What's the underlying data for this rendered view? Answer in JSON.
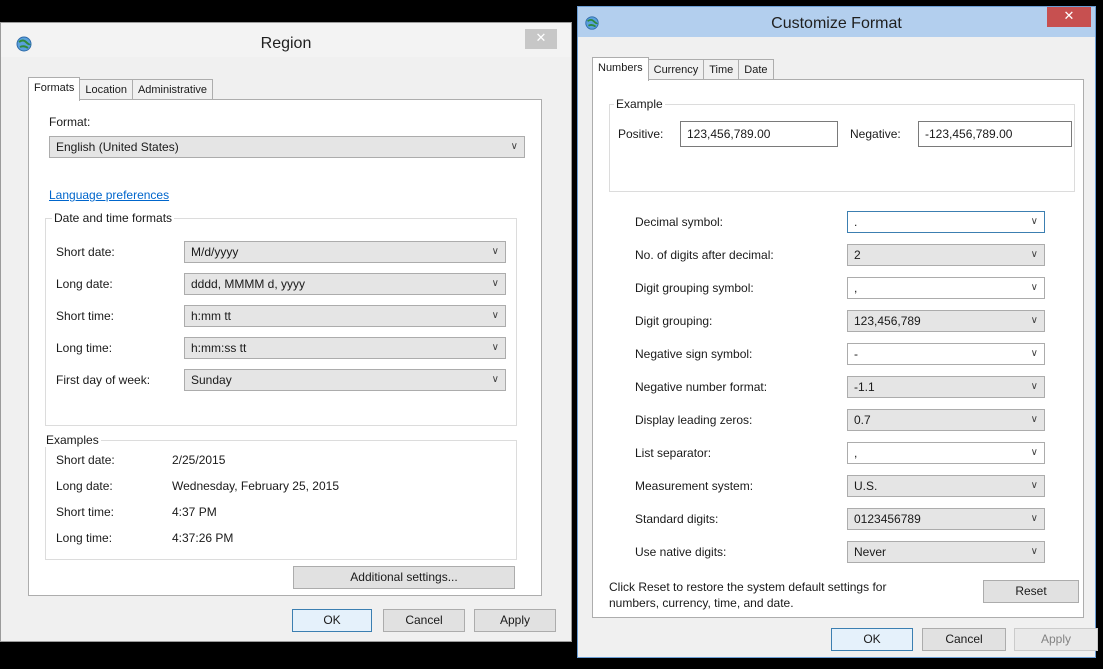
{
  "region": {
    "title": "Region",
    "close_glyph": "✕",
    "tabs": [
      {
        "label": "Formats"
      },
      {
        "label": "Location"
      },
      {
        "label": "Administrative"
      }
    ],
    "format_label": "Format:",
    "format_value": "English (United States)",
    "language_link": "Language preferences",
    "dt_group_title": "Date and time formats",
    "dt_rows": [
      {
        "label": "Short date:",
        "value": "M/d/yyyy"
      },
      {
        "label": "Long date:",
        "value": "dddd, MMMM d, yyyy"
      },
      {
        "label": "Short time:",
        "value": "h:mm tt"
      },
      {
        "label": "Long time:",
        "value": "h:mm:ss tt"
      },
      {
        "label": "First day of week:",
        "value": "Sunday"
      }
    ],
    "examples_title": "Examples",
    "examples": [
      {
        "label": "Short date:",
        "value": "2/25/2015"
      },
      {
        "label": "Long date:",
        "value": "Wednesday, February 25, 2015"
      },
      {
        "label": "Short time:",
        "value": "4:37 PM"
      },
      {
        "label": "Long time:",
        "value": "4:37:26 PM"
      }
    ],
    "additional_settings": "Additional settings...",
    "ok": "OK",
    "cancel": "Cancel",
    "apply": "Apply"
  },
  "custom": {
    "title": "Customize Format",
    "close_glyph": "✕",
    "tabs": [
      {
        "label": "Numbers"
      },
      {
        "label": "Currency"
      },
      {
        "label": "Time"
      },
      {
        "label": "Date"
      }
    ],
    "example_title": "Example",
    "positive_label": "Positive:",
    "positive_value": "123,456,789.00",
    "negative_label": "Negative:",
    "negative_value": "-123,456,789.00",
    "rows": [
      {
        "label": "Decimal symbol:",
        "value": "."
      },
      {
        "label": "No. of digits after decimal:",
        "value": "2"
      },
      {
        "label": "Digit grouping symbol:",
        "value": ","
      },
      {
        "label": "Digit grouping:",
        "value": "123,456,789"
      },
      {
        "label": "Negative sign symbol:",
        "value": "-"
      },
      {
        "label": "Negative number format:",
        "value": "-1.1"
      },
      {
        "label": "Display leading zeros:",
        "value": "0.7"
      },
      {
        "label": "List separator:",
        "value": ","
      },
      {
        "label": "Measurement system:",
        "value": "U.S."
      },
      {
        "label": "Standard digits:",
        "value": "0123456789"
      },
      {
        "label": "Use native digits:",
        "value": "Never"
      }
    ],
    "reset_note_line1": "Click Reset to restore the system default settings for",
    "reset_note_line2": "numbers, currency, time, and date.",
    "reset": "Reset",
    "ok": "OK",
    "cancel": "Cancel",
    "apply": "Apply"
  },
  "icons": {
    "globe": "globe-icon",
    "chevron": "chevron-down-icon"
  },
  "colors": {
    "link": "#0066cc",
    "custom_titlebar": "#b3cfee",
    "close_red": "#c75050"
  }
}
